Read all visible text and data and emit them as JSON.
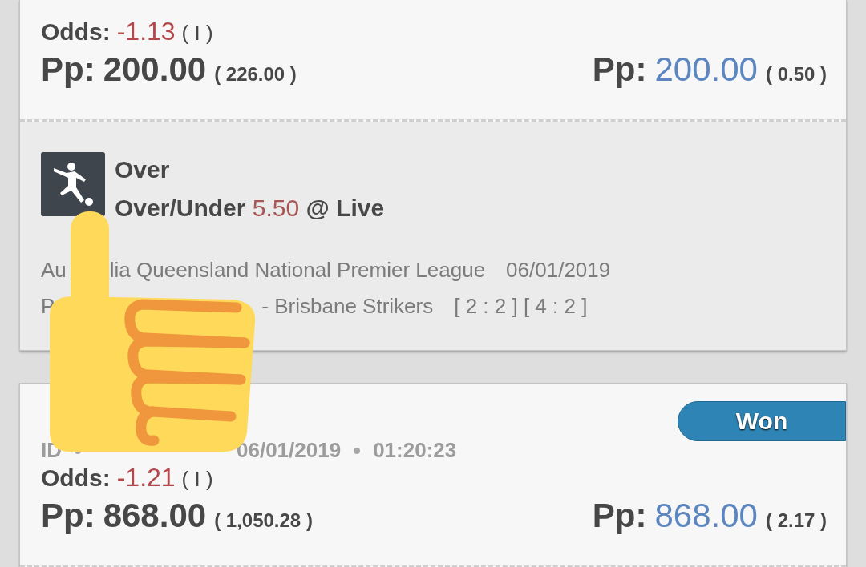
{
  "bets": [
    {
      "odds": {
        "label": "Odds:",
        "value": "-1.13",
        "type": "( I )"
      },
      "stake": {
        "label": "Pp:",
        "value": "200.00",
        "note": "( 226.00 )"
      },
      "payout": {
        "label": "Pp:",
        "value": "200.00",
        "note": "( 0.50 )"
      },
      "selection": {
        "pick": "Over",
        "market": "Over/Under",
        "line": "5.50",
        "suffix": "@ Live",
        "league_start": "Au",
        "league_end": "lia Queensland National Premier League",
        "date": "06/01/2019",
        "teams_start": "P",
        "teams_end": "- Brisbane Strikers",
        "scores": "[ 2 : 2 ] [ 4 : 2 ]"
      }
    },
    {
      "status": "Won",
      "meta": [
        "ID",
        "06/01/2019",
        "01:20:23"
      ],
      "odds": {
        "label": "Odds:",
        "value": "-1.21",
        "type": "( I )"
      },
      "stake": {
        "label": "Pp:",
        "value": "868.00",
        "note": "( 1,050.28 )"
      },
      "payout": {
        "label": "Pp:",
        "value": "868.00",
        "note": "( 2.17 )"
      }
    }
  ]
}
